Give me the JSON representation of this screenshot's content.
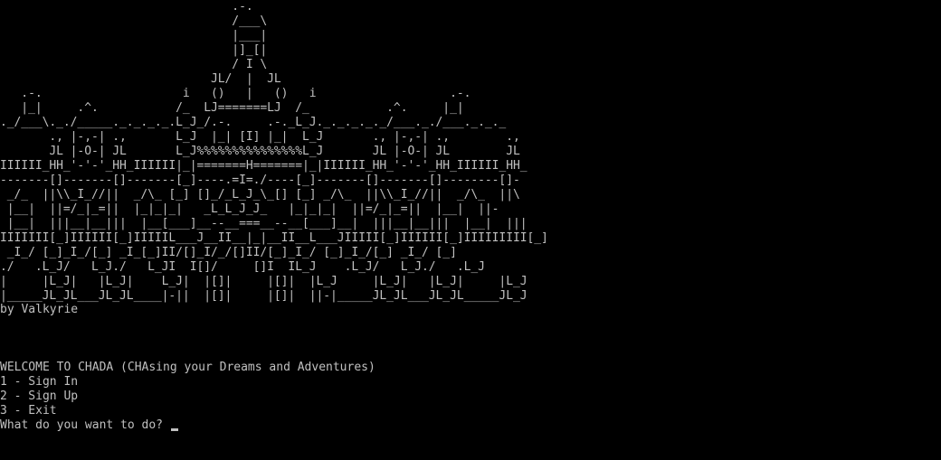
{
  "console": {
    "banner_art": [
      "                                 .-.",
      "                                 /___\\",
      "                                 |___|",
      "                                 |]_[|",
      "                                 / I \\",
      "                              JL/  |  JL",
      "   .-.                    i   ()   |   ()   i                   .-.",
      "   |_|     .^.           /_  LJ=======LJ  /_           .^.     |_|",
      "._/___\\._./_____._._._._.L_J_/.-.     .-._L_J._._._._._/___._./___._._._",
      "       ., |-,-| .,       L_J  |_| [I] |_|  L_J       ., |-,-| .,        .,",
      "       JL |-O-| JL       L_J%%%%%%%%%%%%%%%L_J       JL |-O-| JL        JL",
      "IIIIII_HH_'-'-'_HH_IIIIII|_|=======H=======|_|IIIIII_HH_'-'-'_HH_IIIIII_HH_",
      "-------[]-------[]-------[_]----.=I=./----[_]-------[]-------[]--------[]-",
      " _/_  ||\\\\_I_//||  _/\\_ [_] []_/_L_J_\\_[] [_] _/\\_  ||\\\\_I_//||  _/\\_  ||\\",
      " |__|  ||=/_|_=||  |_|_|_|   _L_L_J_J_   |_|_|_|  ||=/_|_=||  |__|  ||-",
      " |__|  |||__|__|||  |__[___]__--__===__--__[___]__|  |||__|__|||  |__|  |||",
      "IIIIIII[_]IIIIII[_]IIIIIL___J__II__|_|__II__L___JIIIII[_]IIIIII[_]IIIIIIIII[_]",
      " _I_/ [_]_I_/[_] _I_[_]II/[]_I/_/[]II/[_]_I_/ [_]_I_/[_] _I_/ [_]",
      "./   .L_J/   L_J./   L_JI  I[]/     []I  IL_J    .L_J/   L_J./   .L_J",
      "|     |L_J|   |L_J|    L_J|  |[]|     |[]|  |L_J     |L_J|   |L_J|     |L_J",
      "|_____JL_JL___JL_JL____|-||  |[]|     |[]|  ||-|_____JL_JL___JL_JL_____JL_J"
    ],
    "author_line": "by Valkyrie",
    "welcome_line": "WELCOME TO CHADA (CHAsing your Dreams and Adventures)",
    "menu_options": [
      "1 - Sign In",
      "2 - Sign Up",
      "3 - Exit"
    ],
    "prompt": "What do you want to do? ",
    "colors": {
      "background": "#000000",
      "text": "#c0c0c0"
    }
  }
}
